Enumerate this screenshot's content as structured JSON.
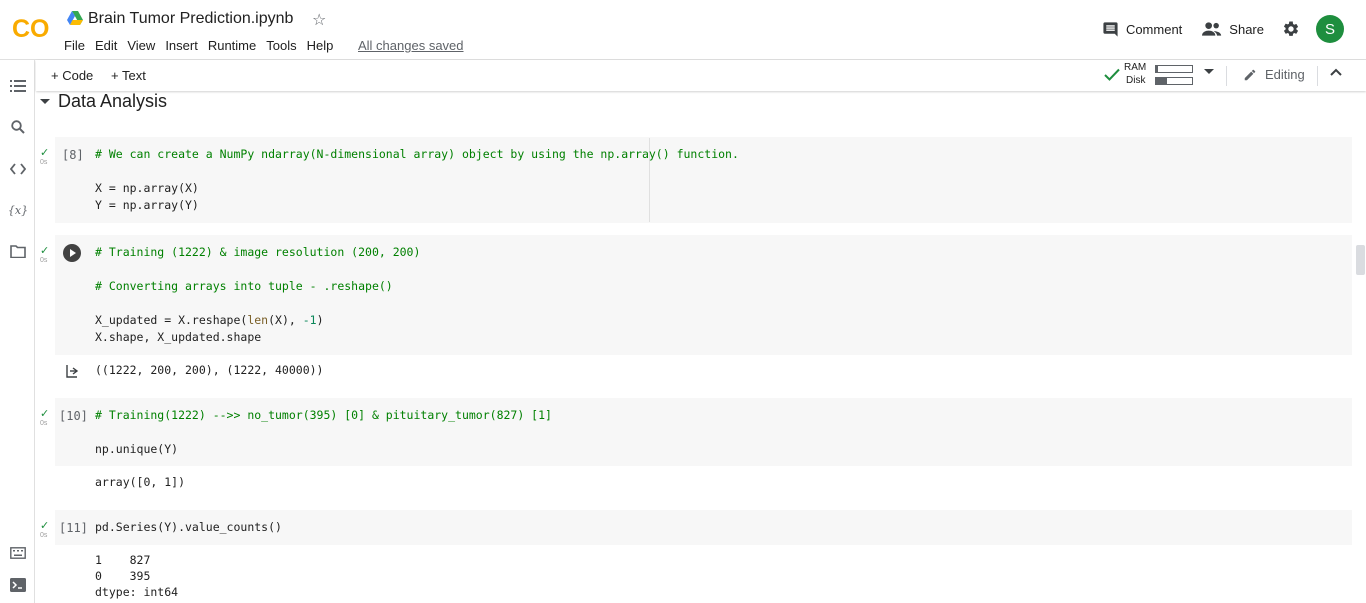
{
  "header": {
    "logo_text": "CO",
    "title": "Brain Tumor Prediction.ipynb",
    "menu": [
      "File",
      "Edit",
      "View",
      "Insert",
      "Runtime",
      "Tools",
      "Help"
    ],
    "saved_status": "All changes saved",
    "comment_label": "Comment",
    "share_label": "Share",
    "avatar_letter": "S",
    "brand_colors": {
      "logo_orange": "#f9ab00",
      "logo_dark": "#e8710a",
      "avatar": "#1e8e3e"
    }
  },
  "toolbar": {
    "add_code_label": "+ Code",
    "add_text_label": "+ Text",
    "ram_label": "RAM",
    "disk_label": "Disk",
    "ram_usage": 0.06,
    "disk_usage": 0.3,
    "editing_label": "Editing"
  },
  "sidebar": {
    "icons": [
      "toc-icon",
      "search-icon",
      "code-snippets-icon",
      "variables-icon",
      "files-icon",
      "command-palette-icon",
      "terminal-icon"
    ],
    "variables_glyph": "{x}"
  },
  "section": {
    "title": "Data Analysis"
  },
  "cells": [
    {
      "exec_label": "[8]",
      "time": "0s",
      "lines": [
        "# We can create a NumPy ndarray(N-dimensional array) object by using the np.array() function.",
        "",
        "X = np.array(X)",
        "Y = np.array(Y)"
      ]
    },
    {
      "exec_label": "",
      "time": "0s",
      "lines": [
        "# Training (1222) & image resolution (200, 200)",
        "",
        "# Converting arrays into tuple - .reshape()",
        "",
        "X_updated = X.reshape(len(X), -1)",
        "X.shape, X_updated.shape"
      ],
      "output": "((1222, 200, 200), (1222, 40000))"
    },
    {
      "exec_label": "[10]",
      "time": "0s",
      "lines": [
        "# Training(1222) -->> no_tumor(395) [0] & pituitary_tumor(827) [1]",
        "",
        "np.unique(Y)"
      ],
      "output": "array([0, 1])"
    },
    {
      "exec_label": "[11]",
      "time": "0s",
      "lines": [
        "pd.Series(Y).value_counts()"
      ],
      "output_lines": [
        "1    827",
        "0    395",
        "dtype: int64"
      ]
    }
  ]
}
